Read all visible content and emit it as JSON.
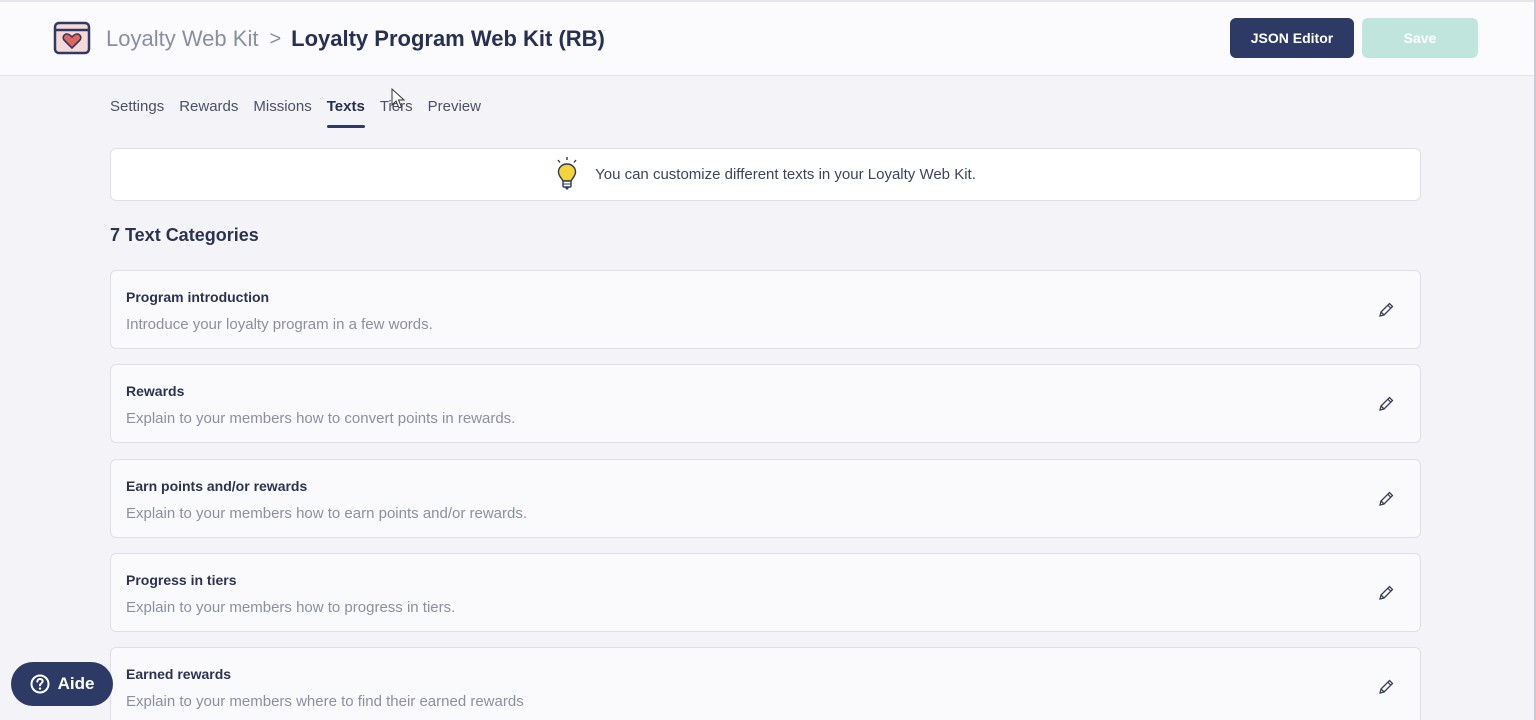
{
  "header": {
    "breadcrumb_parent": "Loyalty Web Kit",
    "breadcrumb_separator": ">",
    "breadcrumb_current": "Loyalty Program Web Kit (RB)",
    "json_editor_label": "JSON Editor",
    "save_label": "Save",
    "logo_icon": "heart-calendar-icon"
  },
  "tabs": [
    {
      "label": "Settings",
      "active": false
    },
    {
      "label": "Rewards",
      "active": false
    },
    {
      "label": "Missions",
      "active": false
    },
    {
      "label": "Texts",
      "active": true
    },
    {
      "label": "Tiers",
      "active": false
    },
    {
      "label": "Preview",
      "active": false
    }
  ],
  "info": {
    "icon": "lightbulb-icon",
    "text": "You can customize different texts in your Loyalty Web Kit."
  },
  "section_title": "7 Text Categories",
  "categories": [
    {
      "title": "Program introduction",
      "description": "Introduce your loyalty program in a few words."
    },
    {
      "title": "Rewards",
      "description": "Explain to your members how to convert points in rewards."
    },
    {
      "title": "Earn points and/or rewards",
      "description": "Explain to your members how to earn points and/or rewards."
    },
    {
      "title": "Progress in tiers",
      "description": "Explain to your members how to progress in tiers."
    },
    {
      "title": "Earned rewards",
      "description": "Explain to your members where to find their earned rewards"
    }
  ],
  "help": {
    "label": "Aide",
    "icon": "question-circle-icon"
  },
  "colors": {
    "primary": "#2c3a65",
    "save_disabled": "#bfe5dc",
    "background": "#f4f4f8",
    "bulb": "#f5d33b"
  }
}
